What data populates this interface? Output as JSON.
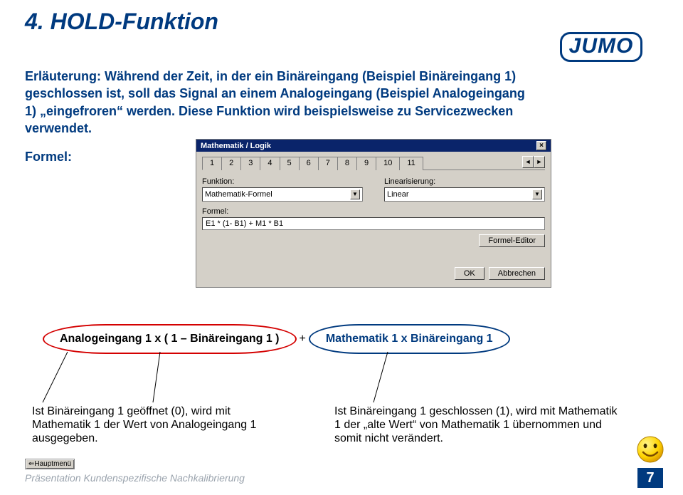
{
  "title": "4. HOLD-Funktion",
  "logo": "JUMO",
  "intro": "Erläuterung: Während der Zeit, in der ein Binäreingang (Beispiel Binäreingang 1) geschlossen ist, soll das Signal an einem Analogeingang (Beispiel Analogeingang 1) „eingefroren“ werden. Diese Funktion wird beispielsweise zu Servicezwecken verwendet.",
  "formel_label": "Formel:",
  "dialog": {
    "title": "Mathematik / Logik",
    "close": "×",
    "tabs": [
      "1",
      "2",
      "3",
      "4",
      "5",
      "6",
      "7",
      "8",
      "9",
      "10",
      "11"
    ],
    "active_tab": 0,
    "scroll_left": "◄",
    "scroll_right": "►",
    "funktion_label": "Funktion:",
    "funktion_value": "Mathematik-Formel",
    "linear_label": "Linearisierung:",
    "linear_value": "Linear",
    "formel_field_label": "Formel:",
    "formel_value": "E1 * (1- B1) + M1 * B1",
    "editor_btn": "Formel-Editor",
    "ok": "OK",
    "cancel": "Abbrechen"
  },
  "formula": {
    "left": "Analogeingang 1  x  ( 1 – Binäreingang 1 )",
    "plus": "+",
    "right": "Mathematik 1  x  Binäreingang 1"
  },
  "caption_left": "Ist Binäreingang 1 geöffnet (0), wird mit Mathematik 1 der Wert von Analogeingang 1 ausgegeben.",
  "caption_right": "Ist Binäreingang 1 geschlossen (1), wird mit Mathematik 1 der „alte Wert“ von Mathematik 1 übernommen und somit nicht verändert.",
  "hauptmenu": "⇐Hauptmenü",
  "footer": "Präsentation Kundenspezifische Nachkalibrierung",
  "page": "7"
}
